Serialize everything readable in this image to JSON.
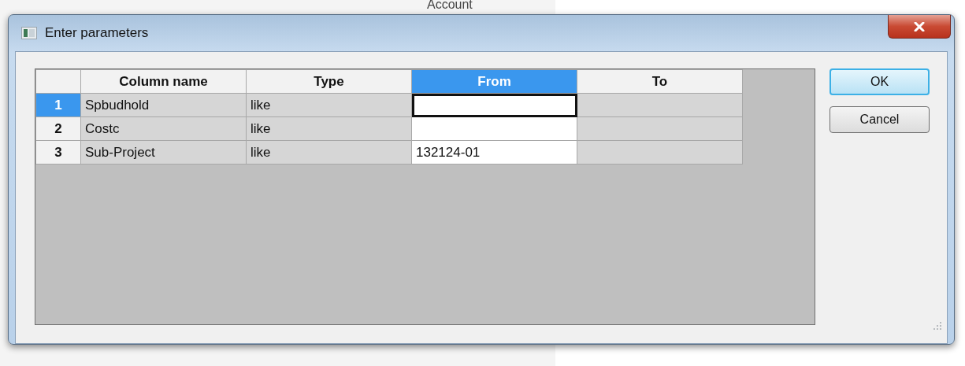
{
  "background": {
    "text": "Account"
  },
  "window": {
    "title": "Enter parameters"
  },
  "table": {
    "columns": [
      {
        "label": "Column name",
        "selected": false
      },
      {
        "label": "Type",
        "selected": false
      },
      {
        "label": "From",
        "selected": true
      },
      {
        "label": "To",
        "selected": false
      }
    ],
    "rows": [
      {
        "number": "1",
        "selected": true,
        "cells": [
          {
            "text": "Spbudhold",
            "editable": false,
            "focused": false
          },
          {
            "text": "like",
            "editable": false,
            "focused": false
          },
          {
            "editable": true,
            "focused": true
          },
          {
            "editable": false,
            "focused": false
          }
        ]
      },
      {
        "number": "2",
        "selected": false,
        "cells": [
          {
            "text": "Costc",
            "editable": false,
            "focused": false
          },
          {
            "text": "like",
            "editable": false,
            "focused": false
          },
          {
            "editable": true,
            "focused": false
          },
          {
            "editable": false,
            "focused": false
          }
        ]
      },
      {
        "number": "3",
        "selected": false,
        "cells": [
          {
            "text": "Sub-Project",
            "editable": false,
            "focused": false
          },
          {
            "text": "like",
            "editable": false,
            "focused": false
          },
          {
            "text": "132124-01",
            "editable": true,
            "focused": false
          },
          {
            "editable": false,
            "focused": false
          }
        ]
      }
    ]
  },
  "buttons": [
    {
      "label": "OK",
      "default": true
    },
    {
      "label": "Cancel",
      "default": false
    }
  ]
}
